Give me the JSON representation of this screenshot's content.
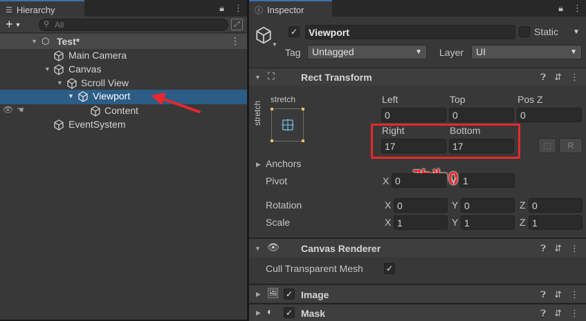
{
  "hierarchy": {
    "tab_label": "Hierarchy",
    "add_label": "+",
    "search_placeholder": "All",
    "scene_name": "Test*",
    "items": [
      "Main Camera",
      "Canvas",
      "Scroll View",
      "Viewport",
      "Content",
      "EventSystem"
    ]
  },
  "inspector": {
    "tab_label": "Inspector",
    "object_name": "Viewport",
    "static_label": "Static",
    "tag_label": "Tag",
    "tag_value": "Untagged",
    "layer_label": "Layer",
    "layer_value": "UI"
  },
  "rect_transform": {
    "title": "Rect Transform",
    "anchor_preset_top": "stretch",
    "anchor_preset_side": "stretch",
    "left_label": "Left",
    "left_value": "0",
    "top_label": "Top",
    "top_value": "0",
    "posz_label": "Pos Z",
    "posz_value": "0",
    "right_label": "Right",
    "right_value": "17",
    "bottom_label": "Bottom",
    "bottom_value": "17",
    "raw_button": "R",
    "anchors_label": "Anchors",
    "pivot_label": "Pivot",
    "pivot_x": "0",
    "pivot_y": "1",
    "rotation_label": "Rotation",
    "rotation": [
      "0",
      "0",
      "0"
    ],
    "scale_label": "Scale",
    "scale": [
      "1",
      "1",
      "1"
    ],
    "axis": [
      "X",
      "Y",
      "Z"
    ]
  },
  "annotation": {
    "text": "改为0",
    "color": "#e8282c"
  },
  "canvas_renderer": {
    "title": "Canvas Renderer",
    "cull_label": "Cull Transparent Mesh"
  },
  "image_component": {
    "title": "Image"
  },
  "mask_component": {
    "title": "Mask"
  },
  "colors": {
    "selection": "#2c5d87",
    "accent": "#3a72b0"
  }
}
